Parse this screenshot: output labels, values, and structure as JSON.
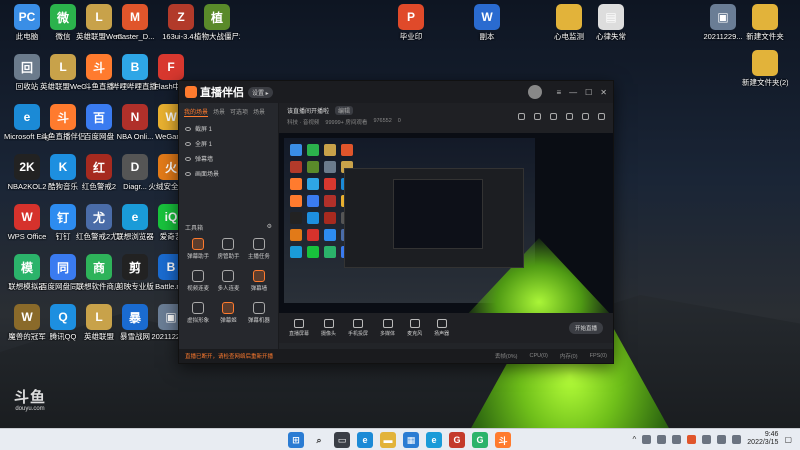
{
  "desktop_icons": [
    {
      "label": "此电脑",
      "color": "#3a8ee6",
      "glyph": "PC"
    },
    {
      "label": "微信",
      "color": "#2bb24c",
      "glyph": "微"
    },
    {
      "label": "英雄联盟WeGame版",
      "color": "#c8a24a",
      "glyph": "L"
    },
    {
      "label": "master_D...",
      "color": "#e0552b",
      "glyph": "M"
    },
    {
      "label": "163ui-3.4...",
      "color": "#b23a2a",
      "glyph": "Z"
    },
    {
      "label": "植物大战僵尸2010年度版",
      "color": "#5a8a2a",
      "glyph": "植"
    },
    {
      "label": "回收站",
      "color": "#6b7b8c",
      "glyph": "回"
    },
    {
      "label": "英雄联盟WeGame版",
      "color": "#c8a24a",
      "glyph": "L"
    },
    {
      "label": "斗鱼直播",
      "color": "#ff7b2e",
      "glyph": "斗"
    },
    {
      "label": "哔哩哔哩直播姬",
      "color": "#2ea6e6",
      "glyph": "B"
    },
    {
      "label": "Flash中心",
      "color": "#d8382f",
      "glyph": "F"
    },
    {
      "label": "Microsoft Edge",
      "color": "#1b8ad6",
      "glyph": "e"
    },
    {
      "label": "斗鱼直播伴侣",
      "color": "#ff7b2e",
      "glyph": "斗"
    },
    {
      "label": "百度网盘",
      "color": "#3a7bf0",
      "glyph": "百"
    },
    {
      "label": "NBA Onli...",
      "color": "#b0302a",
      "glyph": "N"
    },
    {
      "label": "WeGame",
      "color": "#e8b030",
      "glyph": "W"
    },
    {
      "label": "NBA2KOL2",
      "color": "#222",
      "glyph": "2K"
    },
    {
      "label": "酷狗音乐",
      "color": "#1d8fe0",
      "glyph": "K"
    },
    {
      "label": "红色警戒2",
      "color": "#a62a1f",
      "glyph": "红"
    },
    {
      "label": "Diagr...",
      "color": "#555",
      "glyph": "D"
    },
    {
      "label": "火绒安全软件",
      "color": "#e27a18",
      "glyph": "火"
    },
    {
      "label": "WPS Office",
      "color": "#d6322c",
      "glyph": "W"
    },
    {
      "label": "钉钉",
      "color": "#2d8cf0",
      "glyph": "钉"
    },
    {
      "label": "红色警戒2尤里的复仇",
      "color": "#4a6ca8",
      "glyph": "尤"
    },
    {
      "label": "联想浏览器",
      "color": "#1a9bd8",
      "glyph": "e"
    },
    {
      "label": "爱奇艺",
      "color": "#18c23c",
      "glyph": "iQ"
    },
    {
      "label": "联想模拟器",
      "color": "#2bb36a",
      "glyph": "模"
    },
    {
      "label": "百度网盘同步空间",
      "color": "#3a7bf0",
      "glyph": "同"
    },
    {
      "label": "联想软件商店",
      "color": "#2eb35a",
      "glyph": "商"
    },
    {
      "label": "剪映专业版",
      "color": "#222",
      "glyph": "剪"
    },
    {
      "label": "Battle.net",
      "color": "#1a6bd0",
      "glyph": "B"
    },
    {
      "label": "魔兽的冠军",
      "color": "#8a6a2a",
      "glyph": "W"
    },
    {
      "label": "腾讯QQ",
      "color": "#1d8fe0",
      "glyph": "Q"
    },
    {
      "label": "英雄联盟",
      "color": "#c8a24a",
      "glyph": "L"
    },
    {
      "label": "暴雪战网",
      "color": "#1a6bd0",
      "glyph": "暴"
    },
    {
      "label": "20211229...",
      "color": "#6a7d95",
      "glyph": "▣"
    }
  ],
  "right_icons": [
    {
      "label": "毕业印",
      "color": "#e04a2a",
      "glyph": "P"
    },
    {
      "label": "副本",
      "color": "#2a6bd0",
      "glyph": "W"
    },
    {
      "label": "心电监测",
      "color": "#e2b33a",
      "glyph": "📁"
    },
    {
      "label": "心律失常",
      "color": "#ddd",
      "glyph": "▤"
    },
    {
      "label": "20211229...",
      "color": "#6a7d95",
      "glyph": "▣"
    },
    {
      "label": "新建文件夹",
      "color": "#e2b33a",
      "glyph": "📁"
    },
    {
      "label": "新建文件夹(2)",
      "color": "#e2b33a",
      "glyph": "📁"
    }
  ],
  "app": {
    "logo_text": "直播伴侣",
    "version": "设置 ▸",
    "tabs": [
      "我的场景",
      "场景",
      "可选项",
      "场景"
    ],
    "scenes": [
      "截屏 1",
      "全屏 1",
      "弹幕墙",
      "画面场景"
    ],
    "tools_title": "工具箱",
    "tools": [
      {
        "label": "弹幕助手",
        "hot": true
      },
      {
        "label": "房管助手",
        "hot": false
      },
      {
        "label": "主播任务",
        "hot": false
      },
      {
        "label": "视频连麦",
        "hot": false
      },
      {
        "label": "多人连麦",
        "hot": false
      },
      {
        "label": "弹幕墙",
        "hot": true
      },
      {
        "label": "虚拟形象",
        "hot": false
      },
      {
        "label": "弹幕姬",
        "hot": true
      },
      {
        "label": "弹幕机器",
        "hot": false
      }
    ],
    "stream_title": "该直播间开播啦",
    "stream_tag": "编辑",
    "stream_sub": [
      "科技 · 音视频",
      "99999+ 房间观看",
      "976552",
      "0"
    ],
    "bottom_items": [
      "直播屏幕",
      "摄像头",
      "手机投屏",
      "多媒体",
      "麦克风",
      "扬声器"
    ],
    "start_label": "开始直播",
    "status_warn": "直播已断开，请检查网络后重新开播",
    "status_items": [
      "丢帧(0%)",
      "CPU(0)",
      "内存(0)",
      "FPS(0)"
    ]
  },
  "watermark": {
    "glyph": "斗鱼",
    "sub": "douyu.com"
  },
  "clock": {
    "time": "9:46",
    "date": "2022/3/15"
  }
}
